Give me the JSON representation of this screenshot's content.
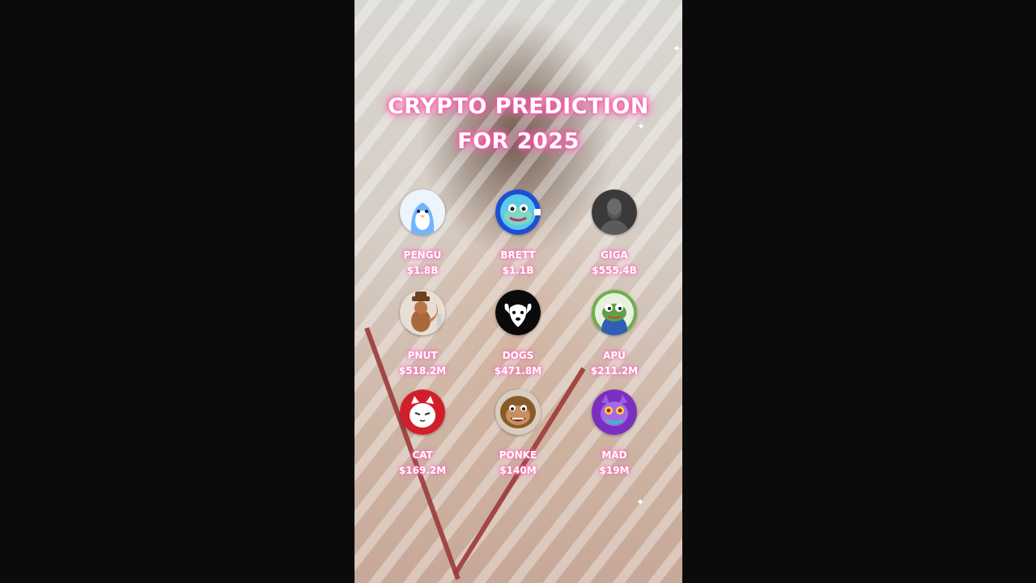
{
  "title": {
    "line1": "CRYPTO PREDICTION",
    "line2": "FOR 2025"
  },
  "colors": {
    "background": "#0b0b0b",
    "title_glow": "#ff4fa8",
    "label_text": "#ffffff"
  },
  "coins": [
    {
      "name": "PENGU",
      "cap": "$1.8B",
      "icon": "penguin-icon"
    },
    {
      "name": "BRETT",
      "cap": "$1.1B",
      "icon": "brett-frog-icon"
    },
    {
      "name": "GIGA",
      "cap": "$555.4B",
      "icon": "gigachad-icon"
    },
    {
      "name": "PNUT",
      "cap": "$518.2M",
      "icon": "squirrel-icon"
    },
    {
      "name": "DOGS",
      "cap": "$471.8M",
      "icon": "dog-icon"
    },
    {
      "name": "APU",
      "cap": "$211.2M",
      "icon": "frog-icon"
    },
    {
      "name": "CAT",
      "cap": "$169.2M",
      "icon": "cat-icon"
    },
    {
      "name": "PONKE",
      "cap": "$140M",
      "icon": "monkey-icon"
    },
    {
      "name": "MAD",
      "cap": "$19M",
      "icon": "purple-creature-icon"
    }
  ]
}
